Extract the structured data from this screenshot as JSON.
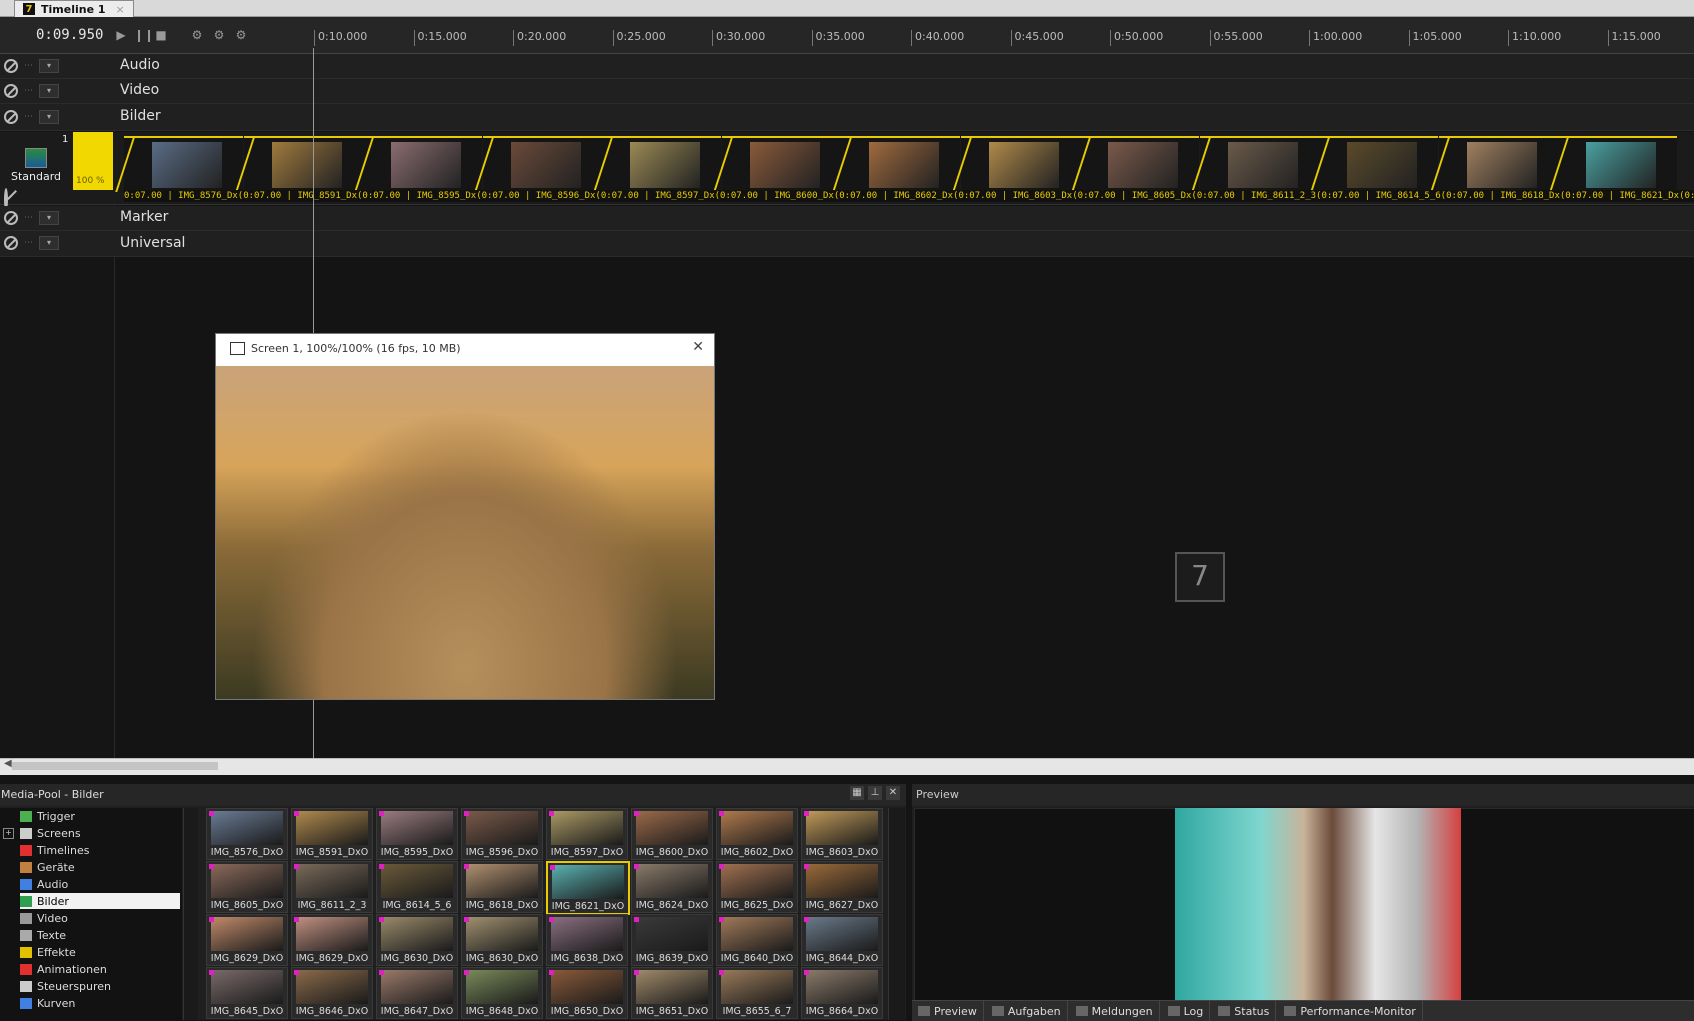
{
  "tab": {
    "logo": "7",
    "title": "Timeline 1",
    "close": "×"
  },
  "toolbar": {
    "timecode": "0:09.950"
  },
  "ruler": [
    "0:10.000",
    "0:15.000",
    "0:20.000",
    "0:25.000",
    "0:30.000",
    "0:35.000",
    "0:40.000",
    "0:45.000",
    "0:50.000",
    "0:55.000",
    "1:00.000",
    "1:05.000",
    "1:10.000",
    "1:15.000"
  ],
  "tracks": {
    "audio": "Audio",
    "video": "Video",
    "bilder": "Bilder",
    "marker": "Marker",
    "universal": "Universal"
  },
  "image_track": {
    "preset": "Standard",
    "number": "1",
    "percent": "100 %"
  },
  "clips": [
    {
      "label": "0:07.00 | IMG_8576_Dx",
      "color": "#5a6c85"
    },
    {
      "label": "0:07.00 | IMG_8591_Dx",
      "color": "#a07a3e"
    },
    {
      "label": "0:07.00 | IMG_8595_Dx",
      "color": "#8a6c70"
    },
    {
      "label": "0:07.00 | IMG_8596_Dx",
      "color": "#6a4a3a"
    },
    {
      "label": "0:07.00 | IMG_8597_Dx",
      "color": "#9b8a55"
    },
    {
      "label": "0:07.00 | IMG_8600_Dx",
      "color": "#8a5a3a"
    },
    {
      "label": "0:07.00 | IMG_8602_Dx",
      "color": "#a06a3e"
    },
    {
      "label": "0:07.00 | IMG_8603_Dx",
      "color": "#b08a4a"
    },
    {
      "label": "0:07.00 | IMG_8605_Dx",
      "color": "#7a5a4a"
    },
    {
      "label": "0:07.00 | IMG_8611_2_3",
      "color": "#6a5a4a"
    },
    {
      "label": "0:07.00 | IMG_8614_5_6",
      "color": "#5a4a2a"
    },
    {
      "label": "0:07.00 | IMG_8618_Dx",
      "color": "#a08060"
    },
    {
      "label": "0:07.00 | IMG_8621_Dx",
      "color": "#4aa0a0"
    }
  ],
  "cliplabels": "0:07.00 | IMG_8576_Dx(0:07.00 | IMG_8591_Dx(0:07.00 | IMG_8595_Dx(0:07.00 | IMG_8596_Dx(0:07.00 | IMG_8597_Dx(0:07.00 | IMG_8600_Dx(0:07.00 | IMG_8602_Dx(0:07.00 | IMG_8603_Dx(0:07.00 | IMG_8605_Dx(0:07.00 | IMG_8611_2_3(0:07.00 | IMG_8614_5_6(0:07.00 | IMG_8618_Dx(0:07.00 | IMG_8621_Dx(0:07.00",
  "screen": {
    "title": "Screen 1, 100%/100% (16 fps, 10 MB)",
    "close": "✕"
  },
  "badge": "7",
  "mediapool": {
    "title": "Media-Pool - Bilder",
    "tree": [
      {
        "label": "Trigger",
        "icon": "trigger-icon",
        "color": "#4caf50"
      },
      {
        "label": "Screens",
        "icon": "screens-icon",
        "color": "#cccccc"
      },
      {
        "label": "Timelines",
        "icon": "timelines-icon",
        "color": "#e03030"
      },
      {
        "label": "Geräte",
        "icon": "devices-icon",
        "color": "#c08040"
      },
      {
        "label": "Audio",
        "icon": "audio-icon",
        "color": "#4080e0"
      },
      {
        "label": "Bilder",
        "icon": "images-icon",
        "color": "#30a050"
      },
      {
        "label": "Video",
        "icon": "video-icon",
        "color": "#999999"
      },
      {
        "label": "Texte",
        "icon": "text-icon",
        "color": "#aaaaaa"
      },
      {
        "label": "Effekte",
        "icon": "effects-icon",
        "color": "#e0c000"
      },
      {
        "label": "Animationen",
        "icon": "animations-icon",
        "color": "#e03030"
      },
      {
        "label": "Steuerspuren",
        "icon": "control-tracks-icon",
        "color": "#cccccc"
      },
      {
        "label": "Kurven",
        "icon": "curves-icon",
        "color": "#4080e0"
      }
    ],
    "items": [
      {
        "label": "IMG_8576_DxO",
        "color": "#6a7c95"
      },
      {
        "label": "IMG_8591_DxO",
        "color": "#b08a4e"
      },
      {
        "label": "IMG_8595_DxO",
        "color": "#9a7c80"
      },
      {
        "label": "IMG_8596_DxO",
        "color": "#7a5a4a"
      },
      {
        "label": "IMG_8597_DxO",
        "color": "#ab9a65"
      },
      {
        "label": "IMG_8600_DxO",
        "color": "#9a6a4a"
      },
      {
        "label": "IMG_8602_DxO",
        "color": "#b07a4e"
      },
      {
        "label": "IMG_8603_DxO",
        "color": "#c09a5a"
      },
      {
        "label": "IMG_8605_DxO",
        "color": "#8a6a5a"
      },
      {
        "label": "IMG_8611_2_3",
        "color": "#7a6a5a"
      },
      {
        "label": "IMG_8614_5_6",
        "color": "#6a5a3a"
      },
      {
        "label": "IMG_8618_DxO",
        "color": "#b09070"
      },
      {
        "label": "IMG_8621_DxO",
        "color": "#5ab0b0"
      },
      {
        "label": "IMG_8624_DxO",
        "color": "#8a7a6a"
      },
      {
        "label": "IMG_8625_DxO",
        "color": "#a07050"
      },
      {
        "label": "IMG_8627_DxO",
        "color": "#9a6a3a"
      },
      {
        "label": "IMG_8629_DxO",
        "color": "#c08a6a"
      },
      {
        "label": "IMG_8629_DxO",
        "color": "#c09080"
      },
      {
        "label": "IMG_8630_DxO",
        "color": "#9a8a6a"
      },
      {
        "label": "IMG_8630_DxO",
        "color": "#a09070"
      },
      {
        "label": "IMG_8638_DxO",
        "color": "#8a7080"
      },
      {
        "label": "IMG_8639_DxO",
        "color": "#3a3a3a"
      },
      {
        "label": "IMG_8640_DxO",
        "color": "#a07a5a"
      },
      {
        "label": "IMG_8644_DxO",
        "color": "#6a7a8a"
      },
      {
        "label": "IMG_8645_DxO",
        "color": "#7a6a6a"
      },
      {
        "label": "IMG_8646_DxO",
        "color": "#8a6a4a"
      },
      {
        "label": "IMG_8647_DxO",
        "color": "#9a7a6a"
      },
      {
        "label": "IMG_8648_DxO",
        "color": "#7a8a5a"
      },
      {
        "label": "IMG_8650_DxO",
        "color": "#8a5a3a"
      },
      {
        "label": "IMG_8651_DxO",
        "color": "#a08a6a"
      },
      {
        "label": "IMG_8655_6_7",
        "color": "#9a7a5a"
      },
      {
        "label": "IMG_8664_DxO",
        "color": "#8a7a6a"
      }
    ]
  },
  "preview": {
    "title": "Preview",
    "tabs": [
      {
        "label": "Preview",
        "icon": "preview-icon"
      },
      {
        "label": "Aufgaben",
        "icon": "tasks-icon"
      },
      {
        "label": "Meldungen",
        "icon": "messages-icon"
      },
      {
        "label": "Log",
        "icon": "log-icon"
      },
      {
        "label": "Status",
        "icon": "status-icon"
      },
      {
        "label": "Performance-Monitor",
        "icon": "performance-icon"
      }
    ]
  }
}
